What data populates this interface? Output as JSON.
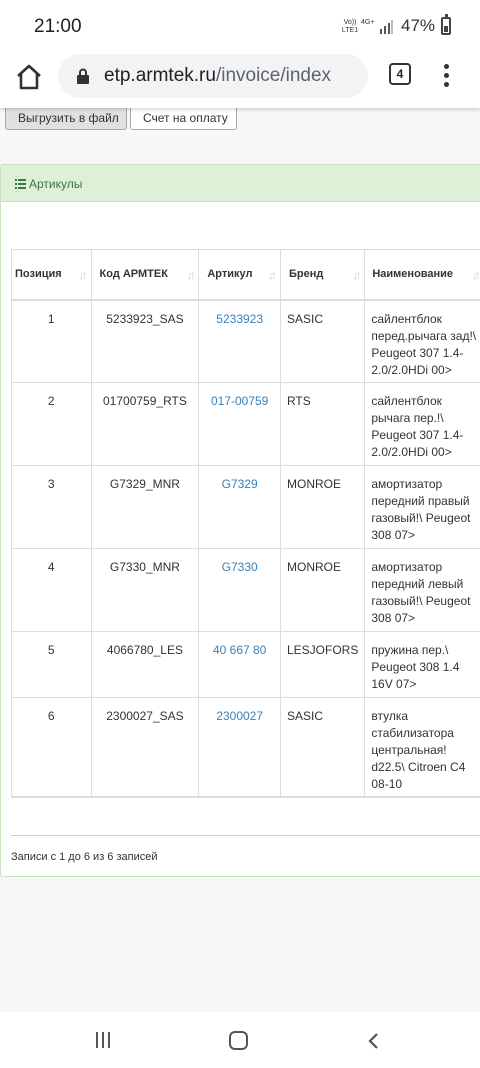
{
  "status_bar": {
    "time": "21:00",
    "network_top": "Vo))",
    "network_bottom": "LTE1",
    "g4": "4G+",
    "battery": "47%"
  },
  "browser": {
    "url_host": "etp.armtek.ru",
    "url_path": "/invoice/index",
    "tab_count": "4"
  },
  "toolbar": {
    "export_label": "Выгрузить в файл",
    "invoice_label": "Счет на оплату"
  },
  "panel": {
    "title": "Артикулы"
  },
  "table": {
    "columns": [
      "Позиция",
      "Код АРМТЕК",
      "Артикул",
      "Бренд",
      "Наименование"
    ],
    "rows": [
      {
        "pos": "1",
        "code": "5233923_SAS",
        "article": "5233923",
        "brand": "SASIC",
        "name": "сайлентблок перед.рычага зад!\\ Peugeot 307 1.4-2.0/2.0HDi 00>"
      },
      {
        "pos": "2",
        "code": "01700759_RTS",
        "article": "017-00759",
        "brand": "RTS",
        "name": "сайлентблок рычага пер.!\\ Peugeot 307 1.4-2.0/2.0HDi 00>"
      },
      {
        "pos": "3",
        "code": "G7329_MNR",
        "article": "G7329",
        "brand": "MONROE",
        "name": "амортизатор передний правый газовый!\\ Peugeot 308 07>"
      },
      {
        "pos": "4",
        "code": "G7330_MNR",
        "article": "G7330",
        "brand": "MONROE",
        "name": "амортизатор передний левый газовый!\\ Peugeot 308 07>"
      },
      {
        "pos": "5",
        "code": "4066780_LES",
        "article": "40 667 80",
        "brand": "LESJOFORS",
        "name": "пружина пер.\\ Peugeot 308 1.4 16V 07>"
      },
      {
        "pos": "6",
        "code": "2300027_SAS",
        "article": "2300027",
        "brand": "SASIC",
        "name": "втулка стабилизатора центральная! d22.5\\ Citroen C4 08-10"
      }
    ]
  },
  "footer": {
    "info": "Записи с 1 до 6 из 6 записей"
  }
}
